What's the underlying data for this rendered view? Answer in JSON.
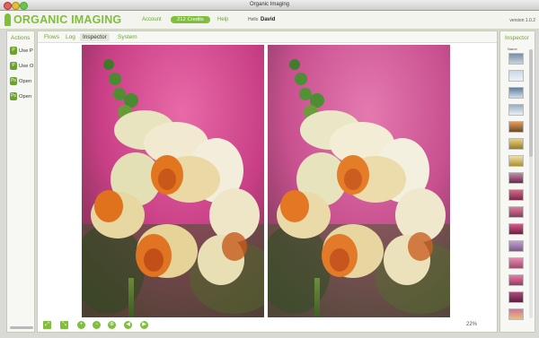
{
  "window": {
    "title": "Organic Imaging"
  },
  "header": {
    "logo_text": "ORGANIC IMAGING",
    "account_label": "Account",
    "credits_label": "212 Credits",
    "help_label": "Help",
    "hello_label": "Hello",
    "user_name": "David",
    "version": "version 1.0.2"
  },
  "actions_panel": {
    "title": "Actions",
    "items": [
      {
        "icon": "p-icon",
        "glyph": "P",
        "label": "Use P"
      },
      {
        "icon": "p-icon",
        "glyph": "P",
        "label": "Use O"
      },
      {
        "icon": "ps-icon",
        "glyph": "Ps",
        "label": "Open"
      },
      {
        "icon": "ps-icon",
        "glyph": "Ps",
        "label": "Open"
      }
    ]
  },
  "main": {
    "tabs": [
      {
        "label": "Flows",
        "active": false
      },
      {
        "label": "Log",
        "active": false
      },
      {
        "label": "Inspector",
        "active": true
      },
      {
        "label": "System",
        "active": false
      }
    ],
    "zoom_level": "22%",
    "toolbar_icons": [
      "fit-screen-icon",
      "actual-size-icon",
      "zoom-in-icon",
      "zoom-out-icon",
      "zoom-fit-icon",
      "previous-icon",
      "next-icon"
    ]
  },
  "inspector_panel": {
    "title": "Inspector",
    "column_header": "Name"
  },
  "colors": {
    "accent": "#7fbf3a",
    "accent_dark": "#6aa42f"
  }
}
